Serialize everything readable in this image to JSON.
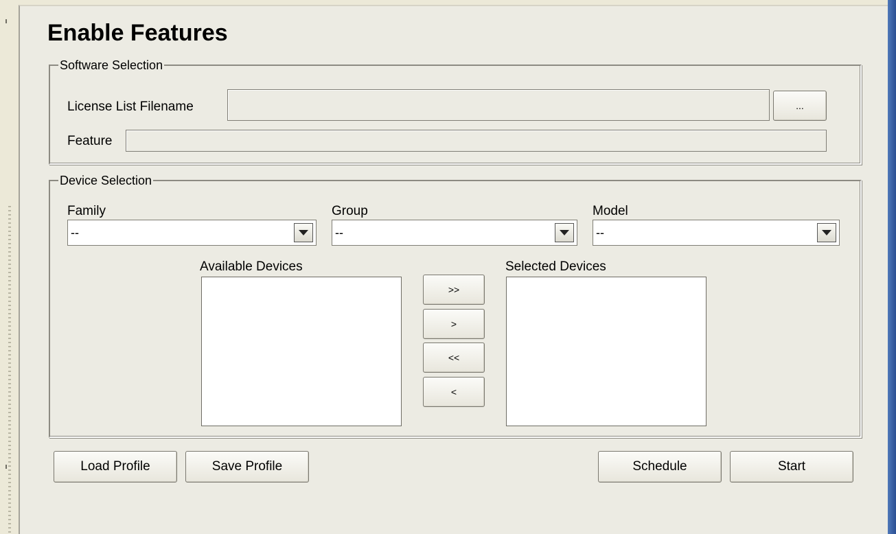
{
  "page": {
    "title": "Enable Features"
  },
  "software_selection": {
    "legend": "Software Selection",
    "license_label": "License List Filename",
    "license_value": "",
    "browse_label": "...",
    "feature_label": "Feature",
    "feature_value": ""
  },
  "device_selection": {
    "legend": "Device Selection",
    "family": {
      "label": "Family",
      "value": "--"
    },
    "group": {
      "label": "Group",
      "value": "--"
    },
    "model": {
      "label": "Model",
      "value": "--"
    },
    "available_label": "Available Devices",
    "selected_label": "Selected Devices",
    "transfer": {
      "add_all": ">>",
      "add_one": ">",
      "remove_all": "<<",
      "remove_one": "<"
    }
  },
  "footer": {
    "load_profile": "Load Profile",
    "save_profile": "Save Profile",
    "schedule": "Schedule",
    "start": "Start"
  },
  "colors": {
    "background": "#ecebe3",
    "window_accent": "#3a62a8"
  }
}
